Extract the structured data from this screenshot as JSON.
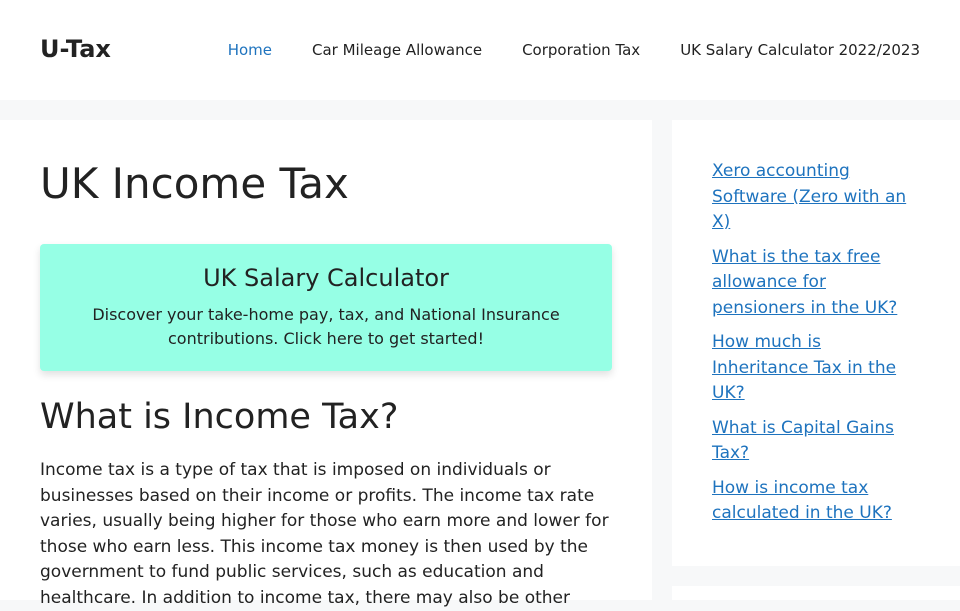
{
  "header": {
    "logo": "U-Tax",
    "nav": [
      {
        "label": "Home",
        "active": true
      },
      {
        "label": "Car Mileage Allowance",
        "active": false
      },
      {
        "label": "Corporation Tax",
        "active": false
      },
      {
        "label": "UK Salary Calculator 2022/2023",
        "active": false
      }
    ]
  },
  "main": {
    "title": "UK Income Tax",
    "cta": {
      "title": "UK Salary Calculator",
      "text": "Discover your take-home pay, tax, and National Insurance contributions. Click here to get started!",
      "background": "#96ffe5"
    },
    "section_heading": "What is Income Tax?",
    "paragraph": "Income tax is a type of tax that is imposed on individuals or businesses based on their income or profits. The income tax rate varies, usually being higher for those who earn more and lower for those who earn less. This income tax money is then used by the government to fund public services, such as education and healthcare. In addition to income tax, there may also be other"
  },
  "sidebar": {
    "links": [
      "Xero accounting Software (Zero with an X)",
      "What is the tax free allowance for pensioners in the UK?",
      "How much is Inheritance Tax in the UK?",
      "What is Capital Gains Tax?",
      "How is income tax calculated in the UK?"
    ]
  },
  "colors": {
    "link": "#1e73be",
    "page_background": "#f7f8f9",
    "text": "#222222"
  }
}
